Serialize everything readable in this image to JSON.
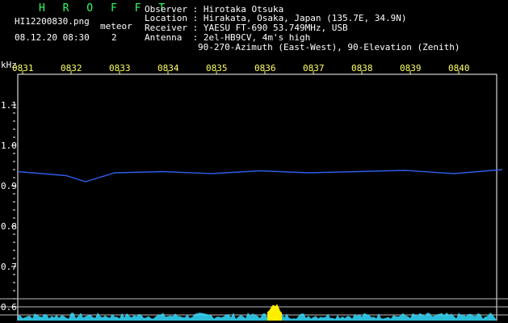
{
  "header": {
    "app_title": "H R O F F T",
    "filename": "HI12200830.png",
    "datetime": "08.12.20 08:30",
    "meteor_label": "meteor",
    "meteor_count": "2"
  },
  "station": {
    "observer": "Observer : Hirotaka Otsuka",
    "location": "Location : Hirakata, Osaka, Japan (135.7E, 34.9N)",
    "receiver": "Receiver : YAESU FT-690 53.749MHz, USB",
    "antenna": "Antenna  : 2el-HB9CV, 4m's high",
    "antenna2": "90-270-Azimuth (East-West), 90-Elevation (Zenith)"
  },
  "chart_data": {
    "type": "line",
    "ylabel": "kHz",
    "x_ticks": [
      "0831",
      "0832",
      "0833",
      "0834",
      "0835",
      "0836",
      "0837",
      "0838",
      "0839",
      "0840"
    ],
    "y_ticks": [
      "1.1",
      "1.0",
      "0.9",
      "0.8",
      "0.7",
      "0.6"
    ],
    "ylim": [
      0.58,
      1.14
    ],
    "grid": false,
    "trace_color": "#3366ff",
    "activity_color": "#33ddff",
    "meteor_color": "#ffee00",
    "carrier": {
      "x": [
        0.0,
        1.0,
        1.4,
        2.0,
        3.0,
        4.0,
        5.0,
        6.0,
        7.0,
        8.0,
        9.0,
        10.0
      ],
      "y": [
        0.935,
        0.925,
        0.91,
        0.932,
        0.935,
        0.93,
        0.937,
        0.932,
        0.935,
        0.938,
        0.93,
        0.94
      ]
    },
    "meteor_burst": {
      "x_start": 5.05,
      "x_end": 5.35,
      "label": "meteor"
    }
  }
}
